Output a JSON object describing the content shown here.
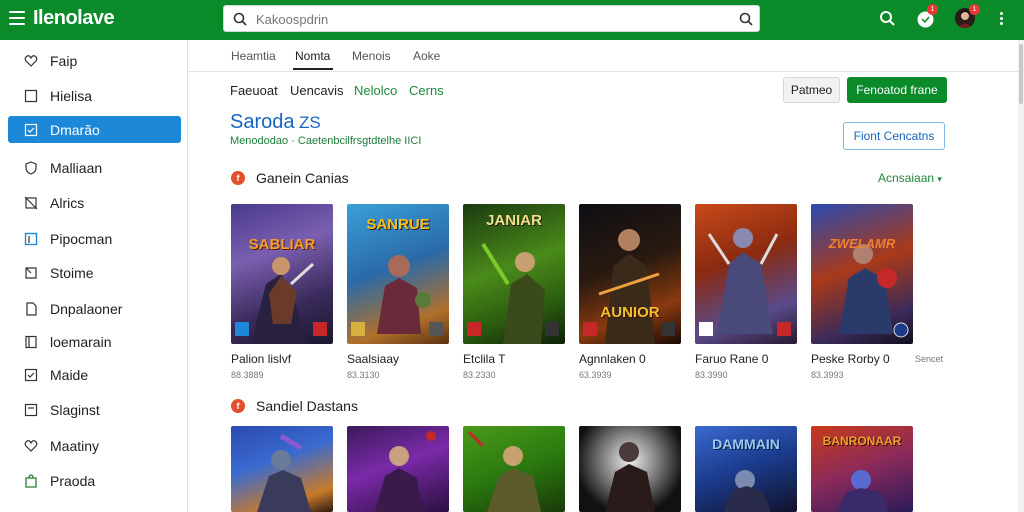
{
  "app": {
    "logo_text": "Ilenolave"
  },
  "search": {
    "placeholder": "Kakoospdrin"
  },
  "header": {
    "notif_count": "1",
    "profile_count": "1"
  },
  "sidebar": {
    "items": [
      {
        "label": "Faip",
        "icon": "heart-icon"
      },
      {
        "label": "Hielisa",
        "icon": "square-icon"
      },
      {
        "label": "Dmarão",
        "icon": "grid-icon"
      },
      {
        "label": "Malliaan",
        "icon": "shield-icon"
      },
      {
        "label": "Alrics",
        "icon": "crossed-square-icon"
      },
      {
        "label": "Pipocman",
        "icon": "flag-icon"
      },
      {
        "label": "Stoime",
        "icon": "star-icon"
      },
      {
        "label": "Dnpalaoner",
        "icon": "doc-icon"
      },
      {
        "label": "loemarain",
        "icon": "book-icon"
      },
      {
        "label": "Maide",
        "icon": "check-icon"
      },
      {
        "label": "Slaginst",
        "icon": "tag-icon"
      },
      {
        "label": "Maatiny",
        "icon": "chat-icon"
      },
      {
        "label": "Praoda",
        "icon": "bag-icon"
      }
    ]
  },
  "tabs": [
    {
      "label": "Heamtia"
    },
    {
      "label": "Nomta"
    },
    {
      "label": "Menois"
    },
    {
      "label": "Aoke"
    }
  ],
  "filters": [
    {
      "label": "Faeuoat"
    },
    {
      "label": "Uencavis"
    },
    {
      "label": "Nelolco"
    },
    {
      "label": "Cerns"
    }
  ],
  "buttons": {
    "secondary": "Patmeo",
    "primary": "Fenoatod frane",
    "outline": "Fiont Cencatns"
  },
  "page": {
    "heading": "Saroda",
    "heading_suffix": "ZS",
    "subline": "Menododao · Caetenbcilfrsgtdtelhe IICI"
  },
  "sections": [
    {
      "title": "Ganein Canias",
      "icon_text": "f",
      "see_all": "Acnsaiaan"
    },
    {
      "title": "Sandiel Dastans",
      "icon_text": "f"
    }
  ],
  "cards_row1": [
    {
      "title": "Palion lislvf",
      "sub": "88.3889",
      "art": "SABLIAR"
    },
    {
      "title": "Saalsiaay",
      "sub": "83.3130",
      "art": "SANRUE"
    },
    {
      "title": "Etclila T",
      "sub": "83.2330",
      "art": "JANIAR"
    },
    {
      "title": "Agnnlaken 0",
      "sub": "63.3939",
      "art": "AUNIOR"
    },
    {
      "title": "Faruo Rane 0",
      "sub": "83.3990",
      "art": ""
    },
    {
      "title": "Peske Rorby 0",
      "sub": "83.3993",
      "tag": "Sencet",
      "art": "ZWELAMR"
    }
  ],
  "cards_row2": [
    {
      "art": ""
    },
    {
      "art": ""
    },
    {
      "art": ""
    },
    {
      "art": ""
    },
    {
      "art": "DAMMAIN"
    },
    {
      "art": "BANRONAAR"
    }
  ],
  "colors": {
    "brand": "#0b8a2a",
    "accent": "#1e88d8",
    "link": "#1565c0"
  }
}
